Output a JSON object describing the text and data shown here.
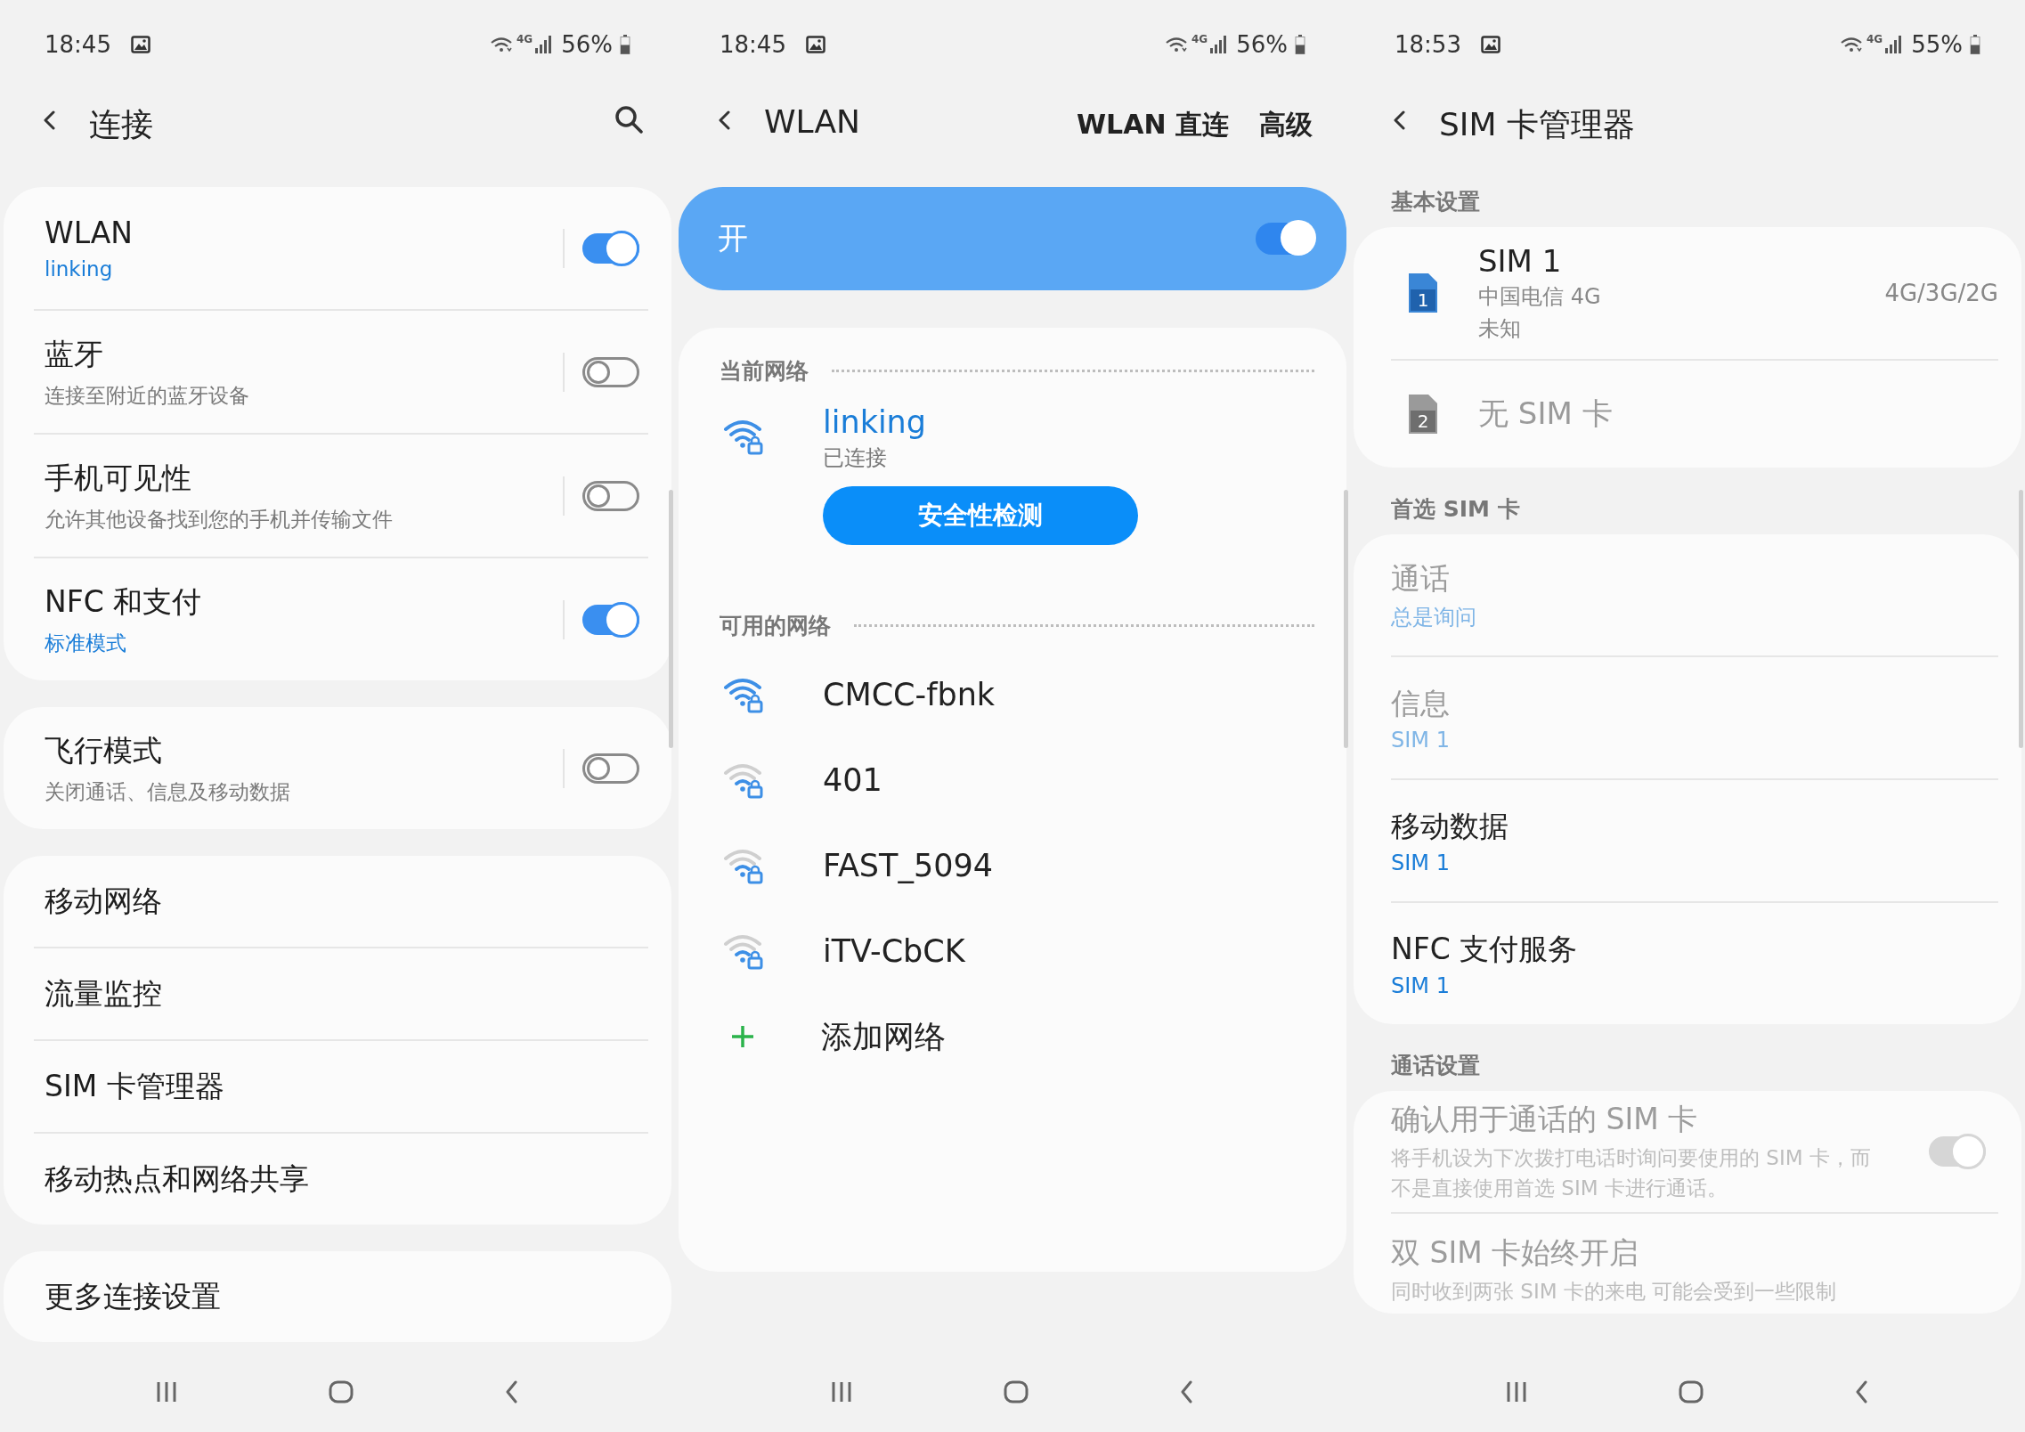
{
  "panels": [
    {
      "kind": "connections",
      "status": {
        "time": "18:45",
        "network": "4G",
        "battery": "56%"
      },
      "header": {
        "title": "连接",
        "search": true
      },
      "groups": [
        [
          {
            "title": "WLAN",
            "subtitle": "linking",
            "accent": true,
            "toggle": {
              "on": true,
              "disabled": false
            }
          },
          {
            "title": "蓝牙",
            "subtitle": "连接至附近的蓝牙设备",
            "accent": false,
            "toggle": {
              "on": false,
              "disabled": false
            }
          },
          {
            "title": "手机可见性",
            "subtitle": "允许其他设备找到您的手机并传输文件",
            "accent": false,
            "toggle": {
              "on": false,
              "disabled": false
            }
          },
          {
            "title": "NFC 和支付",
            "subtitle": "标准模式",
            "accent": true,
            "toggle": {
              "on": true,
              "disabled": false
            }
          }
        ],
        [
          {
            "title": "飞行模式",
            "subtitle": "关闭通话、信息及移动数据",
            "accent": false,
            "toggle": {
              "on": false,
              "disabled": false
            }
          }
        ],
        [
          {
            "title": "移动网络"
          },
          {
            "title": "流量监控"
          },
          {
            "title": "SIM 卡管理器"
          },
          {
            "title": "移动热点和网络共享"
          }
        ],
        [
          {
            "title": "更多连接设置"
          }
        ]
      ]
    },
    {
      "kind": "wlan",
      "status": {
        "time": "18:45",
        "network": "4G",
        "battery": "56%"
      },
      "header": {
        "title": "WLAN",
        "actions": [
          "WLAN 直连",
          "高级"
        ]
      },
      "master": {
        "label": "开",
        "on": true
      },
      "current": {
        "heading": "当前网络",
        "name": "linking",
        "state": "已连接",
        "button": "安全性检测",
        "weak_signal": false
      },
      "available": {
        "heading": "可用的网络",
        "networks": [
          {
            "name": "CMCC-fbnk",
            "weak_signal": false
          },
          {
            "name": "401",
            "weak_signal": true
          },
          {
            "name": "FAST_5094",
            "weak_signal": true
          },
          {
            "name": "iTV-CbCK",
            "weak_signal": true
          }
        ],
        "add": "添加网络"
      }
    },
    {
      "kind": "sim",
      "status": {
        "time": "18:53",
        "network": "4G",
        "battery": "55%"
      },
      "header": {
        "title": "SIM 卡管理器"
      },
      "sections": [
        {
          "heading": "基本设置",
          "items": [
            {
              "kind": "sim",
              "slot": "1",
              "active": true,
              "title": "SIM 1",
              "lines": [
                "中国电信 4G",
                "未知"
              ],
              "mode": "4G/3G/2G"
            },
            {
              "kind": "sim",
              "slot": "2",
              "active": false,
              "title": "无 SIM 卡"
            }
          ]
        },
        {
          "heading": "首选 SIM 卡",
          "items": [
            {
              "kind": "pref",
              "title": "通话",
              "subtitle": "总是询问",
              "disabled": true
            },
            {
              "kind": "pref",
              "title": "信息",
              "subtitle": "SIM 1",
              "disabled": true
            },
            {
              "kind": "pref",
              "title": "移动数据",
              "subtitle": "SIM 1",
              "disabled": false
            },
            {
              "kind": "pref",
              "title": "NFC 支付服务",
              "subtitle": "SIM 1",
              "disabled": false
            }
          ]
        },
        {
          "heading": "通话设置",
          "items": [
            {
              "kind": "switch",
              "title": "确认用于通话的 SIM 卡",
              "subtitle": "将手机设为下次拨打电话时询问要使用的 SIM 卡，而不是直接使用首选 SIM 卡进行通话。",
              "disabled": true,
              "toggle": {
                "on": true,
                "disabled": true
              }
            },
            {
              "kind": "switch",
              "title": "双 SIM 卡始终开启",
              "subtitle": "同时收到两张 SIM 卡的来电 可能会受到一些限制",
              "disabled": true
            }
          ]
        }
      ]
    }
  ]
}
